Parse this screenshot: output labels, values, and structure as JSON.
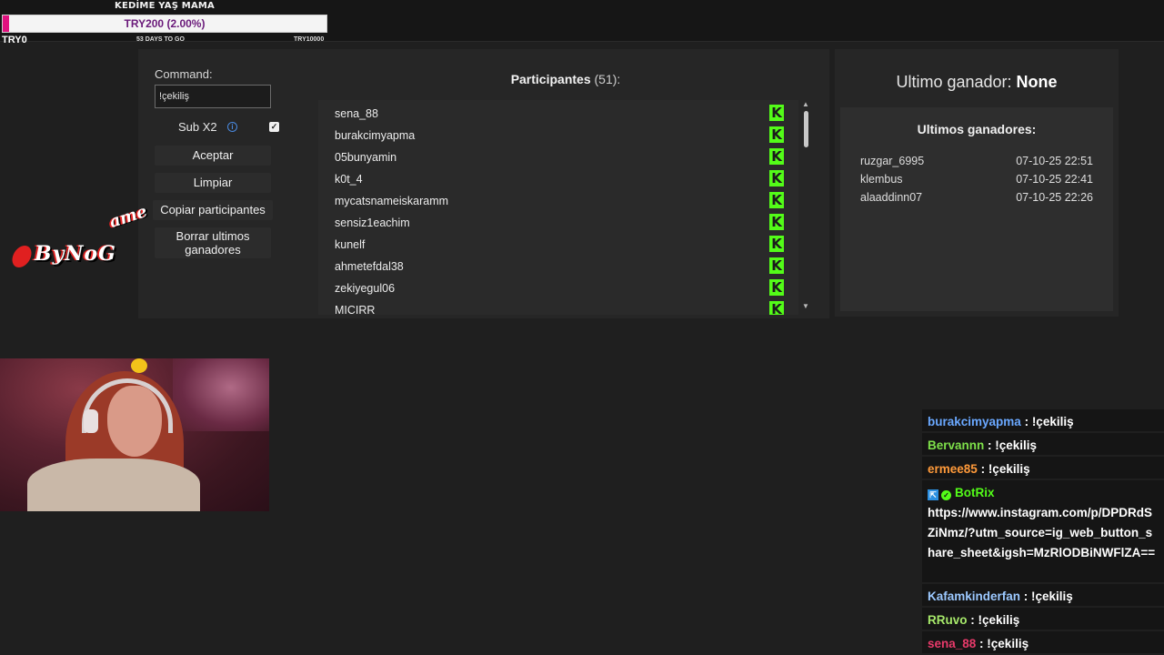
{
  "goal": {
    "title": "KEDİME YAŞ MAMA",
    "progress_text": "TRY200 (2.00%)",
    "progress_fraction": 0.02,
    "left_label": "TRY0",
    "mid_label": "53 DAYS TO GO",
    "right_label": "TRY10000",
    "fill_color": "#e0117f"
  },
  "controls": {
    "command_label": "Command:",
    "command_value": "!çekiliş",
    "sub_label": "Sub X2",
    "sub_checked_glyph": "✓",
    "info_glyph": "i",
    "accept_label": "Aceptar",
    "clear_label": "Limpiar",
    "copy_label": "Copiar participantes",
    "delete_label": "Borrar ultimos ganadores"
  },
  "participants": {
    "title": "Participantes",
    "count": "(51):",
    "badge_glyph": "K",
    "badge_color": "#53fc18",
    "list": [
      "sena_88",
      "burakcimyapma",
      "05bunyamin",
      "k0t_4",
      "mycatsnameiskaramm",
      "sensiz1eachim",
      "kunelf",
      "ahmetefdal38",
      "zekiyegul06",
      "MICIRR"
    ]
  },
  "winners": {
    "last_label": "Ultimo ganador:",
    "last_value": "None",
    "list_title": "Ultimos ganadores:",
    "list": [
      {
        "name": "ruzgar_6995",
        "date": "07-10-25 22:51"
      },
      {
        "name": "klembus",
        "date": "07-10-25 22:41"
      },
      {
        "name": "alaaddinn07",
        "date": "07-10-25 22:26"
      }
    ]
  },
  "logo": {
    "text": "ByNoG",
    "extra": "ame"
  },
  "chat": [
    {
      "user": "burakcimyapma",
      "color_class": "u-blue",
      "text": "!çekiliş"
    },
    {
      "user": "Bervannn",
      "color_class": "u-green",
      "text": "!çekiliş"
    },
    {
      "user": "ermee85",
      "color_class": "u-orange",
      "text": "!çekiliş"
    },
    {
      "user": "BotRix",
      "color_class": "u-botrix",
      "text": "https://www.instagram.com/p/DPDRdSZiNmz/?utm_source=ig_web_button_share_sheet&igsh=MzRlODBiNWFlZA=="
    },
    {
      "user": "Kafamkinderfan",
      "color_class": "u-lightblue",
      "text": "!çekiliş"
    },
    {
      "user": "RRuvo",
      "color_class": "u-lightgreen",
      "text": "!çekiliş"
    },
    {
      "user": "sena_88",
      "color_class": "u-red",
      "text": "!çekiliş"
    }
  ]
}
